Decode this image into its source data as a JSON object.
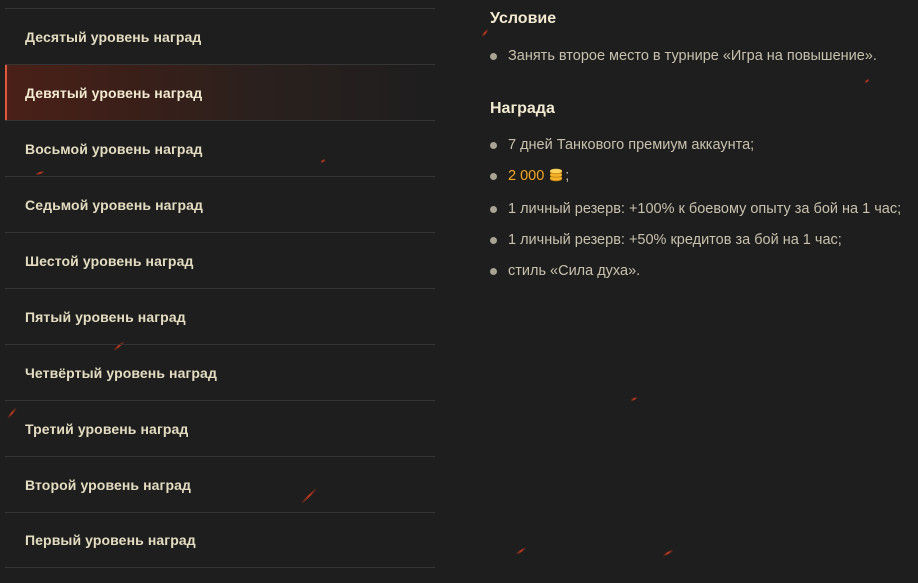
{
  "sidebar": {
    "items": [
      {
        "label": "Десятый уровень наград"
      },
      {
        "label": "Девятый уровень наград"
      },
      {
        "label": "Восьмой уровень наград"
      },
      {
        "label": "Седьмой уровень наград"
      },
      {
        "label": "Шестой уровень наград"
      },
      {
        "label": "Пятый уровень наград"
      },
      {
        "label": "Четвёртый уровень наград"
      },
      {
        "label": "Третий уровень наград"
      },
      {
        "label": "Второй уровень наград"
      },
      {
        "label": "Первый уровень наград"
      }
    ],
    "active_index": 1
  },
  "condition": {
    "title": "Условие",
    "items": [
      "Занять второе место в турнире «Игра на повышение»."
    ]
  },
  "reward": {
    "title": "Награда",
    "item_premium": "7 дней Танкового премиум аккаунта;",
    "gold_value": "2 000",
    "gold_icon": "gold-coins-icon",
    "gold_suffix": ";",
    "item_reserve_xp": "1 личный резерв: +100% к боевому опыту за бой на 1 час;",
    "item_reserve_credits": "1 личный резерв: +50% кредитов за бой на 1 час;",
    "item_style": "стиль «Сила духа»."
  },
  "colors": {
    "background": "#1e1e1e",
    "accent": "#e0583a",
    "gold": "#f5a623",
    "text": "#c8c1ad",
    "heading": "#f2ead0"
  }
}
